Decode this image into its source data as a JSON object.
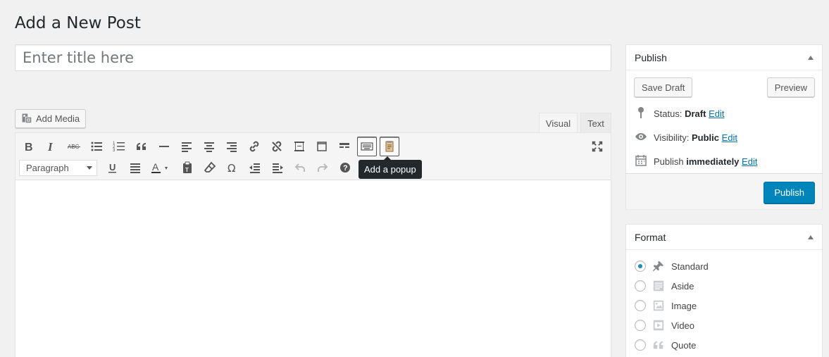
{
  "page": {
    "title": "Add a New Post"
  },
  "title_field": {
    "placeholder": "Enter title here",
    "value": ""
  },
  "media": {
    "add_media_label": "Add Media"
  },
  "editor": {
    "tabs": [
      {
        "label": "Visual",
        "active": true
      },
      {
        "label": "Text",
        "active": false
      }
    ],
    "format_select": {
      "selected": "Paragraph"
    },
    "toolbar_row1": [
      "bold-icon",
      "italic-icon",
      "strikethrough-icon",
      "bulleted-list-icon",
      "numbered-list-icon",
      "blockquote-icon",
      "horizontal-line-icon",
      "align-left-icon",
      "align-center-icon",
      "align-right-icon",
      "insert-link-icon",
      "remove-link-icon",
      "insert-more-icon",
      "insert-page-break-icon",
      "toolbar-toggle-icon",
      "keyboard-icon",
      "popup-icon"
    ],
    "toolbar_row2": [
      "underline-icon",
      "justify-icon",
      "text-color-icon",
      "paste-as-text-icon",
      "clear-formatting-icon",
      "special-character-icon",
      "outdent-icon",
      "indent-icon",
      "undo-icon",
      "redo-icon",
      "help-icon"
    ],
    "tooltip": "Add a popup"
  },
  "publish": {
    "title": "Publish",
    "save_draft_label": "Save Draft",
    "preview_label": "Preview",
    "status_label": "Status:",
    "status_value": "Draft",
    "visibility_label": "Visibility:",
    "visibility_value": "Public",
    "schedule_label": "Publish",
    "schedule_value": "immediately",
    "edit_label": "Edit",
    "publish_button": "Publish"
  },
  "format": {
    "title": "Format",
    "options": [
      {
        "label": "Standard",
        "icon": "pushpin-icon",
        "checked": true
      },
      {
        "label": "Aside",
        "icon": "aside-icon",
        "checked": false
      },
      {
        "label": "Image",
        "icon": "image-icon",
        "checked": false
      },
      {
        "label": "Video",
        "icon": "video-icon",
        "checked": false
      },
      {
        "label": "Quote",
        "icon": "quote-icon",
        "checked": false
      }
    ]
  },
  "colors": {
    "primary": "#0085ba",
    "link": "#0073aa",
    "background": "#f1f1f1"
  }
}
